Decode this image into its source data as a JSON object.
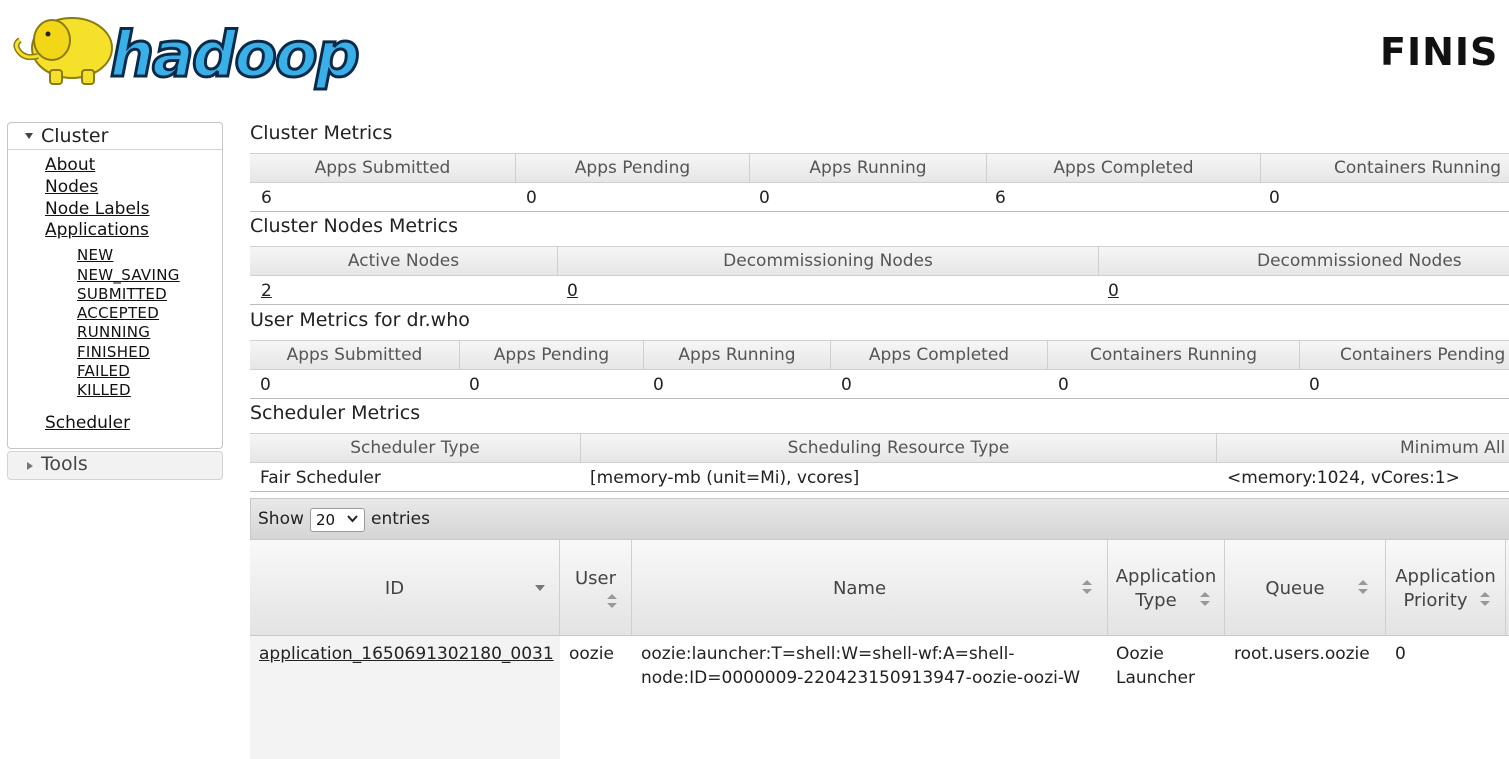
{
  "header": {
    "title": "FINIS"
  },
  "sidebar": {
    "cluster_label": "Cluster",
    "tools_label": "Tools",
    "links": {
      "about": "About",
      "nodes": "Nodes",
      "node_labels": "Node Labels",
      "applications": "Applications",
      "scheduler": "Scheduler"
    },
    "app_states": [
      "NEW",
      "NEW_SAVING",
      "SUBMITTED",
      "ACCEPTED",
      "RUNNING",
      "FINISHED",
      "FAILED",
      "KILLED"
    ]
  },
  "cluster_metrics": {
    "title": "Cluster Metrics",
    "headers": [
      "Apps Submitted",
      "Apps Pending",
      "Apps Running",
      "Apps Completed",
      "Containers Running"
    ],
    "values": [
      "6",
      "0",
      "0",
      "6",
      "0"
    ]
  },
  "cluster_nodes_metrics": {
    "title": "Cluster Nodes Metrics",
    "headers": [
      "Active Nodes",
      "Decommissioning Nodes",
      "Decommissioned Nodes"
    ],
    "values": [
      "2",
      "0",
      "0"
    ]
  },
  "user_metrics": {
    "title": "User Metrics for dr.who",
    "headers": [
      "Apps Submitted",
      "Apps Pending",
      "Apps Running",
      "Apps Completed",
      "Containers Running",
      "Containers Pending"
    ],
    "values": [
      "0",
      "0",
      "0",
      "0",
      "0",
      "0"
    ]
  },
  "scheduler_metrics": {
    "title": "Scheduler Metrics",
    "headers": [
      "Scheduler Type",
      "Scheduling Resource Type",
      "Minimum All"
    ],
    "values": [
      "Fair Scheduler",
      "[memory-mb (unit=Mi), vcores]",
      "<memory:1024, vCores:1>"
    ]
  },
  "apps_table": {
    "show_label": "Show",
    "entries_label": "entries",
    "page_size": "20",
    "columns": {
      "id": "ID",
      "user": "User",
      "name": "Name",
      "app_type": [
        "Application",
        "Type"
      ],
      "queue": "Queue",
      "priority": [
        "Application",
        "Priority"
      ]
    },
    "rows": [
      {
        "id": "application_1650691302180_0031",
        "user": "oozie",
        "name": [
          "oozie:launcher:T=shell:W=shell-wf:A=shell-",
          "node:ID=0000009-220423150913947-oozie-oozi-W"
        ],
        "app_type": [
          "Oozie",
          "Launcher"
        ],
        "queue": "root.users.oozie",
        "priority": "0"
      }
    ]
  },
  "colors": {
    "logo_blue": "#3ab0e8",
    "logo_yellow": "#f5e02a",
    "header_gradient_top": "#f6f6f6",
    "header_gradient_bottom": "#e6e6e6"
  }
}
